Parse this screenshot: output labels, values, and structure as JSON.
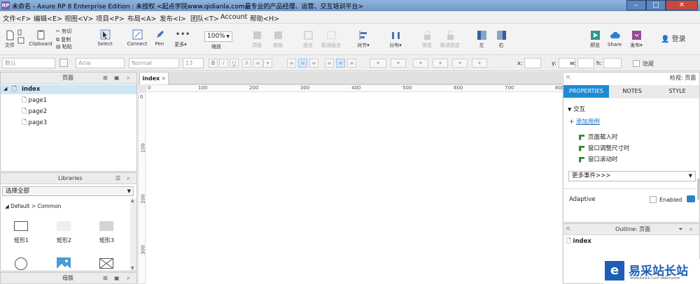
{
  "window": {
    "app_icon": "RP",
    "title": "未命名 - Axure RP 8 Enterprise Edition : 未授权    <起点学院www.qidianla.com最专业的产品经理、运营、交互培训平台>"
  },
  "menu": [
    "文件<F>",
    "编辑<E>",
    "视图<V>",
    "项目<P>",
    "布局<A>",
    "发布<I>",
    "团队<T>",
    "Account",
    "帮助<H>"
  ],
  "toolbar": {
    "file": "文件",
    "clipboard": "Clipboard",
    "cut": "剪切",
    "copy": "复制",
    "paste": "粘贴",
    "select": "Select",
    "connect": "Connect",
    "pen": "Pen",
    "more": "更多▾",
    "zoom": "100%",
    "zoom_label": "缩放",
    "top": "顶层",
    "bottom": "底层",
    "group": "组合",
    "ungroup": "取消组合",
    "align": "对齐▾",
    "distribute": "分布▾",
    "lock": "锁定",
    "unlock": "取消锁定",
    "left": "左",
    "right": "右",
    "preview": "预览",
    "share": "Share",
    "publish": "发布▾",
    "login": "登录"
  },
  "format": {
    "style": "默认",
    "font": "Arial",
    "font_style": "Normal",
    "size": "13",
    "x_label": "x:",
    "y_label": "y:",
    "w_label": "w:",
    "h_label": "h:",
    "hidden": "隐藏"
  },
  "pages_panel": {
    "title": "页面",
    "items": [
      "index",
      "page1",
      "page2",
      "page3"
    ]
  },
  "libraries_panel": {
    "title": "Libraries",
    "select": "选择全部",
    "group": "Default > Common",
    "items": [
      "矩形1",
      "矩形2",
      "矩形3"
    ]
  },
  "masters_panel": {
    "title": "母版"
  },
  "canvas": {
    "tab": "index",
    "hticks": [
      "0",
      "100",
      "200",
      "300",
      "400",
      "500",
      "600",
      "700",
      "800"
    ],
    "vticks": [
      "0",
      "100",
      "200",
      "300"
    ]
  },
  "inspector": {
    "title": "检视: 页面",
    "tabs": [
      "PROPERTIES",
      "NOTES",
      "STYLE"
    ],
    "section": "交互",
    "add_case": "添加用例",
    "events": [
      "页面载入时",
      "窗口调整尺寸时",
      "窗口滚动时"
    ],
    "more_events": "更多事件>>>",
    "adaptive": "Adaptive",
    "enabled": "Enabled"
  },
  "outline": {
    "title": "Outline: 页面",
    "item": "index"
  },
  "watermark": {
    "text": "易采站长站",
    "sub": "Www.Easck.Com  Webmaster"
  }
}
